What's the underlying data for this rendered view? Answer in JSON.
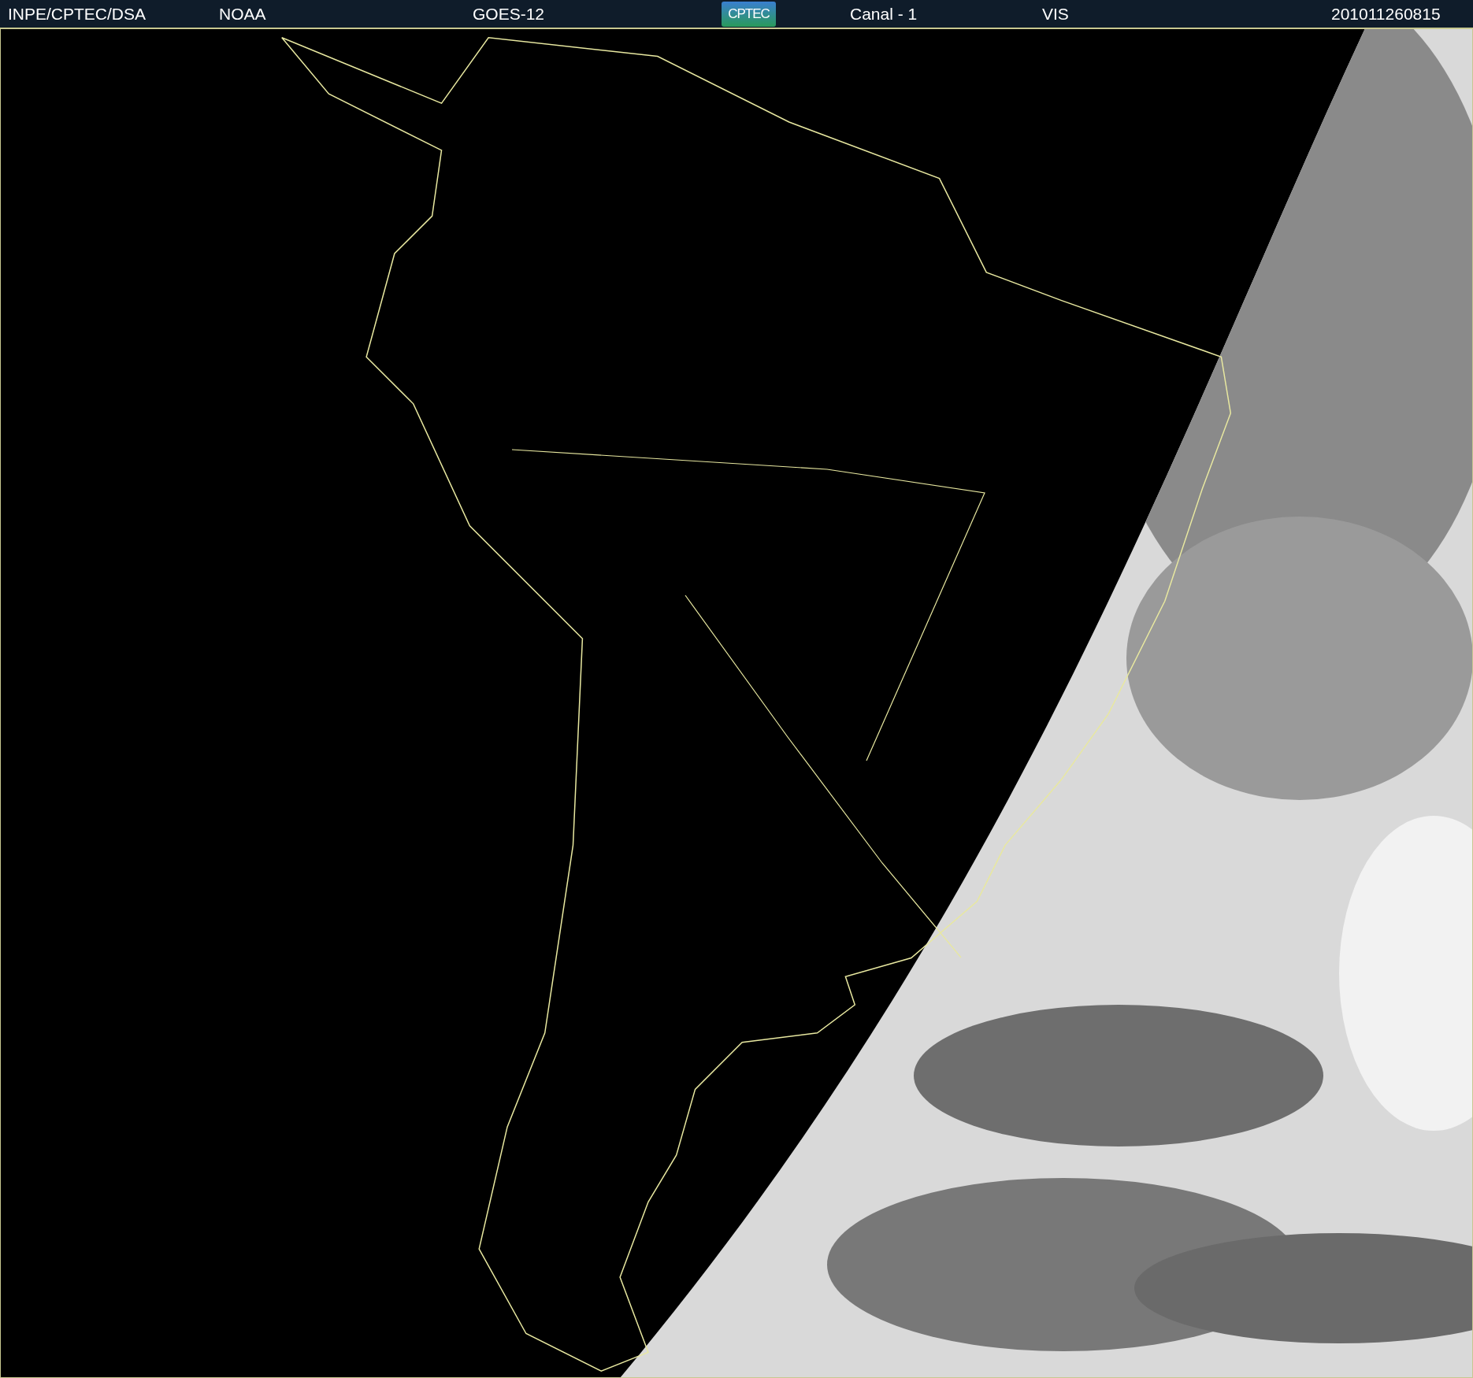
{
  "header": {
    "items": [
      {
        "kind": "text",
        "text": "INPE/CPTEC/DSA"
      },
      {
        "kind": "text",
        "text": "NOAA"
      },
      {
        "kind": "text",
        "text": "GOES-12"
      },
      {
        "kind": "logo",
        "text": "CPTEC"
      },
      {
        "kind": "text",
        "text": "Canal - 1"
      },
      {
        "kind": "text",
        "text": "VIS"
      },
      {
        "kind": "text",
        "text": "201011260815"
      }
    ]
  }
}
